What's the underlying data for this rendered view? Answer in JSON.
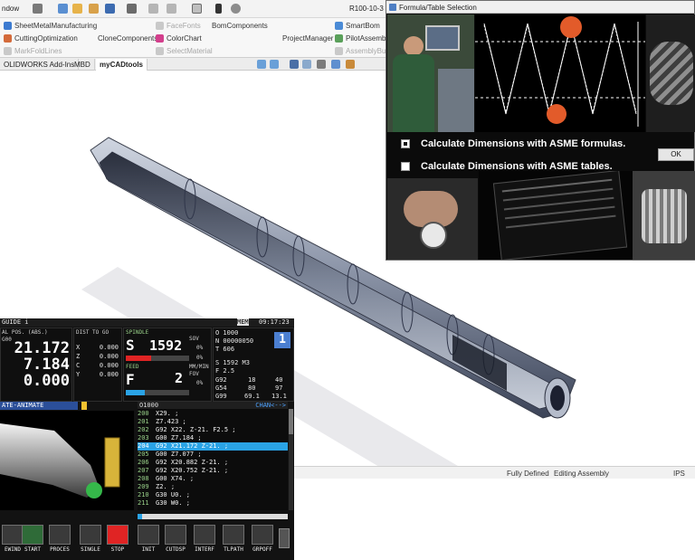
{
  "cad": {
    "titlebar": {
      "menu_window": "ndow",
      "doc_title": "R100-10-3"
    },
    "ribbon": {
      "items": [
        "SheetMetalManufacturing",
        "CuttingOptimization",
        "MarkFoldLines",
        "CloneComponents",
        "FaceFonts",
        "ColorChart",
        "SelectMaterial",
        "BomComponents",
        "ProjectManager",
        "SmartBom",
        "PilotAssembly",
        "AssemblyBu"
      ]
    },
    "tabs": [
      "OLIDWORKS Add-Ins",
      "MBD",
      "myCADtools"
    ],
    "status": {
      "state": "Fully Defined",
      "mode": "Editing Assembly",
      "units": "IPS"
    }
  },
  "dialog": {
    "title": "Formula/Table Selection",
    "options": [
      {
        "label": "Calculate Dimensions with ASME formulas.",
        "checked": true
      },
      {
        "label": "Calculate Dimensions with ASME tables.",
        "checked": false
      }
    ],
    "ok": "OK"
  },
  "cnc": {
    "top": {
      "guide": "GUIDE i",
      "mem": "MEM",
      "time": "09:17:23"
    },
    "pos_header": "AL POS. (ABS.)",
    "g_code": "G00",
    "pos": [
      "21.172",
      "7.184",
      "0.000"
    ],
    "dist_header": "DIST TO GO",
    "axes": [
      "X",
      "Z",
      "C",
      "Y"
    ],
    "dist": [
      "0.000",
      "0.000",
      "0.000",
      "0.000"
    ],
    "spindle_label": "SPINDLE",
    "spindle_letter": "S",
    "spindle_value": "1592",
    "sov_label": "SOV",
    "sov_value": "0%",
    "feed_label": "FEED",
    "feed_letter": "F",
    "feed_value": "2",
    "feed_pct": "0%",
    "mmmin_label": "MM/MIN",
    "fov_label": "FOV",
    "fov_value": "0%",
    "right_info": [
      "O 1000",
      "N 00000050",
      "T 606"
    ],
    "status_num": "1",
    "s_line": "S      1592 M3",
    "f_line": "F        2.5",
    "g_rows": [
      [
        "G92",
        "18",
        "40"
      ],
      [
        "G54",
        "80",
        "97"
      ],
      [
        "G99",
        "69.1",
        "13.1"
      ]
    ],
    "anim_header": "ATE-ANIMATE",
    "prog_header": "O1000",
    "prog_chan": "CHAN<-->",
    "program": [
      {
        "n": "200",
        "code": "X29. ;"
      },
      {
        "n": "201",
        "code": "Z7.423 ;"
      },
      {
        "n": "202",
        "code": "G92 X22. Z-21. F2.5 ;"
      },
      {
        "n": "203",
        "code": "G00 Z7.184 ;"
      },
      {
        "n": "204",
        "code": "G92 X21.172 Z-21. ;"
      },
      {
        "n": "205",
        "code": "G00 Z7.077 ;"
      },
      {
        "n": "206",
        "code": "G92 X20.882 Z-21. ;"
      },
      {
        "n": "207",
        "code": "G92 X20.752 Z-21. ;"
      },
      {
        "n": "208",
        "code": "G00 X74. ;"
      },
      {
        "n": "209",
        "code": "Z2. ;"
      },
      {
        "n": "210",
        "code": "G30 U0. ;"
      },
      {
        "n": "211",
        "code": "G30 W0. ;"
      }
    ],
    "softkeys": [
      "EWIND",
      "START",
      "PROCES",
      "SINGLE",
      "STOP",
      "INIT",
      "CUTDSP",
      "INTERF",
      "TLPATH",
      "GRPOFF"
    ],
    "softkey_icons": [
      "rewind-icon",
      "play-icon",
      "process-icon",
      "single-block-icon",
      "stop-icon",
      "init-icon",
      "cut-display-icon",
      "interference-icon",
      "tool-path-icon",
      "graphic-off-icon"
    ],
    "colors": {
      "accent": "#2aa3e6",
      "header": "#2b4f99",
      "stop": "#e02424",
      "number": "#9ad28a"
    }
  }
}
